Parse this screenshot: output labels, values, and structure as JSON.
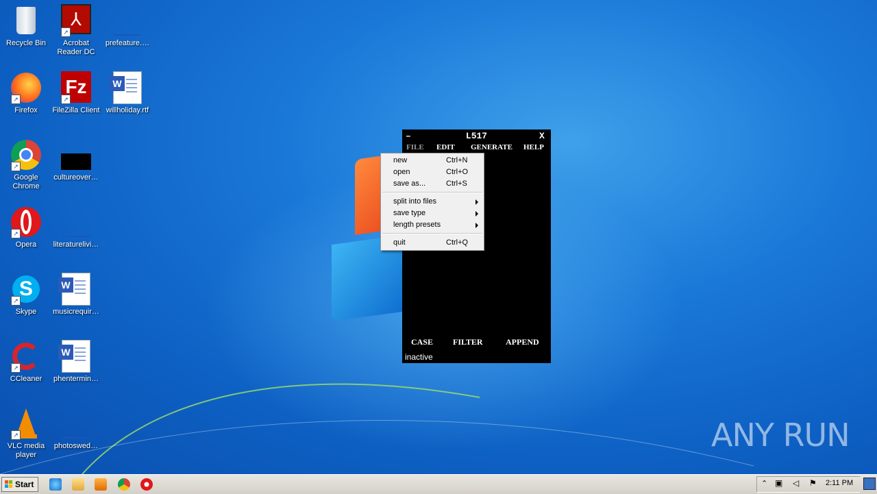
{
  "desktop": {
    "icons": [
      {
        "label": "Recycle Bin",
        "icon": "recycle-bin-icon"
      },
      {
        "label": "Acrobat Reader DC",
        "icon": "acrobat-icon"
      },
      {
        "label": "prefeature.…",
        "icon": "file-icon"
      },
      {
        "label": "Firefox",
        "icon": "firefox-icon"
      },
      {
        "label": "FileZilla Client",
        "icon": "filezilla-icon"
      },
      {
        "label": "willholiday.rtf",
        "icon": "word-doc-icon"
      },
      {
        "label": "Google Chrome",
        "icon": "chrome-icon"
      },
      {
        "label": "cultureover…",
        "icon": "file-icon"
      },
      {
        "label": "Opera",
        "icon": "opera-icon"
      },
      {
        "label": "literaturelivi…",
        "icon": "file-icon"
      },
      {
        "label": "Skype",
        "icon": "skype-icon"
      },
      {
        "label": "musicrequir…",
        "icon": "word-doc-icon"
      },
      {
        "label": "CCleaner",
        "icon": "ccleaner-icon"
      },
      {
        "label": "phentermin…",
        "icon": "word-doc-icon"
      },
      {
        "label": "VLC media player",
        "icon": "vlc-icon"
      },
      {
        "label": "photoswed…",
        "icon": "file-icon"
      }
    ],
    "watermark": "ANY RUN"
  },
  "app": {
    "title": "L517",
    "minimize": "–",
    "close": "X",
    "menus": [
      "FILE",
      "EDIT",
      "GENERATE",
      "HELP"
    ],
    "bottom_buttons": [
      "CASE",
      "FILTER",
      "APPEND"
    ],
    "status": "inactive"
  },
  "file_menu": {
    "items": [
      {
        "label": "new",
        "shortcut": "Ctrl+N"
      },
      {
        "label": "open",
        "shortcut": "Ctrl+O"
      },
      {
        "label": "save as...",
        "shortcut": "Ctrl+S"
      },
      {
        "label": "split into files",
        "shortcut": ""
      },
      {
        "label": "save type",
        "shortcut": ""
      },
      {
        "label": "length presets",
        "shortcut": ""
      },
      {
        "label": "quit",
        "shortcut": "Ctrl+Q"
      }
    ]
  },
  "taskbar": {
    "start_label": "Start",
    "clock": "2:11 PM",
    "pinned": [
      "ie-icon",
      "explorer-icon",
      "media-player-icon",
      "chrome-icon",
      "opera-icon"
    ]
  }
}
